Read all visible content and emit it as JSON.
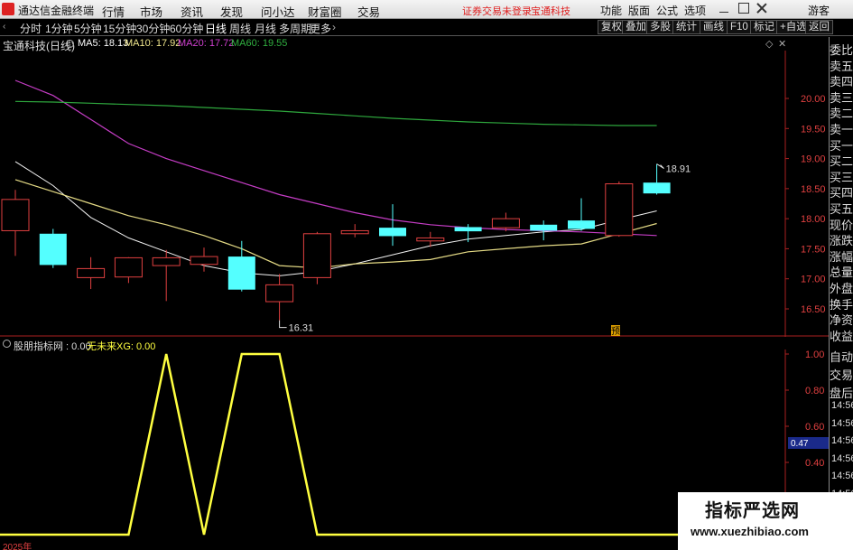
{
  "menubar": {
    "app_title": "通达信金融终端",
    "menus": [
      "行情",
      "市场",
      "资讯",
      "发现",
      "问小达",
      "财富圈",
      "交易"
    ],
    "notice_login": "证券交易未登录",
    "notice_stock": "宝通科技",
    "right_items": [
      "功能",
      "版面",
      "公式",
      "选项"
    ],
    "user": "游客"
  },
  "periodbar": {
    "periods": [
      "分时",
      "1分钟",
      "5分钟",
      "15分钟",
      "30分钟",
      "60分钟",
      "日线",
      "周线",
      "月线",
      "多周期",
      "更多"
    ],
    "active_period": "日线",
    "tools": [
      "复权",
      "叠加",
      "多股",
      "统计",
      "画线",
      "F10",
      "标记",
      "+自选",
      "返回"
    ]
  },
  "main_info": {
    "stock_label": "宝通科技(日线)",
    "ma5": "MA5: 18.13",
    "ma10": "MA10: 17.92",
    "ma20": "MA20: 17.72",
    "ma60": "MA60: 19.55"
  },
  "sub_info": {
    "indicator": "股朋指标网 : 0.00",
    "xg": "无未来XG: 0.00"
  },
  "colors": {
    "up": "#e04040",
    "down": "#54ffff",
    "ma5": "#ffffff",
    "ma10": "#f0e68c",
    "ma20": "#d040d0",
    "ma60": "#30b040",
    "indicator": "#ffff40"
  },
  "annotations": {
    "high": "18.91",
    "low": "16.31",
    "pre_badge": "预"
  },
  "chart_data": [
    {
      "type": "candlestick",
      "title": "宝通科技(日线)",
      "y_ticks": [
        "20.00",
        "19.50",
        "19.00",
        "18.50",
        "18.00",
        "17.50",
        "17.00",
        "16.50"
      ],
      "ylim": [
        16.2,
        20.5
      ],
      "candles": [
        {
          "open": 17.8,
          "close": 18.32,
          "high": 18.48,
          "low": 17.38
        },
        {
          "open": 17.75,
          "close": 17.23,
          "high": 17.83,
          "low": 17.18
        },
        {
          "open": 17.02,
          "close": 17.17,
          "high": 17.36,
          "low": 16.83
        },
        {
          "open": 17.03,
          "close": 17.35,
          "high": 17.36,
          "low": 16.93
        },
        {
          "open": 17.22,
          "close": 17.35,
          "high": 17.48,
          "low": 16.63
        },
        {
          "open": 17.24,
          "close": 17.37,
          "high": 17.52,
          "low": 17.12
        },
        {
          "open": 17.37,
          "close": 16.82,
          "high": 17.63,
          "low": 16.79
        },
        {
          "open": 16.62,
          "close": 16.9,
          "high": 17.08,
          "low": 16.31
        },
        {
          "open": 17.02,
          "close": 17.75,
          "high": 17.78,
          "low": 16.91
        },
        {
          "open": 17.75,
          "close": 17.8,
          "high": 17.91,
          "low": 17.69
        },
        {
          "open": 17.85,
          "close": 17.71,
          "high": 18.24,
          "low": 17.55
        },
        {
          "open": 17.63,
          "close": 17.68,
          "high": 17.78,
          "low": 17.53
        },
        {
          "open": 17.86,
          "close": 17.79,
          "high": 17.91,
          "low": 17.61
        },
        {
          "open": 17.85,
          "close": 18.0,
          "high": 18.1,
          "low": 17.79
        },
        {
          "open": 17.9,
          "close": 17.8,
          "high": 17.97,
          "low": 17.64
        },
        {
          "open": 17.97,
          "close": 17.83,
          "high": 18.34,
          "low": 17.8
        },
        {
          "open": 17.72,
          "close": 18.58,
          "high": 18.62,
          "low": 17.7
        },
        {
          "open": 18.6,
          "close": 18.42,
          "high": 18.91,
          "low": 18.4
        }
      ],
      "series": [
        {
          "name": "MA5",
          "values": [
            18.95,
            18.55,
            18.02,
            17.68,
            17.45,
            17.22,
            17.1,
            17.05,
            17.12,
            17.25,
            17.4,
            17.55,
            17.66,
            17.72,
            17.78,
            17.82,
            17.98,
            18.13
          ]
        },
        {
          "name": "MA10",
          "values": [
            18.65,
            18.45,
            18.25,
            18.05,
            17.9,
            17.72,
            17.5,
            17.22,
            17.18,
            17.25,
            17.28,
            17.32,
            17.45,
            17.5,
            17.55,
            17.58,
            17.75,
            17.92
          ]
        },
        {
          "name": "MA20",
          "values": [
            20.3,
            20.05,
            19.65,
            19.25,
            19.0,
            18.8,
            18.6,
            18.4,
            18.25,
            18.1,
            17.98,
            17.9,
            17.85,
            17.82,
            17.8,
            17.78,
            17.75,
            17.72
          ]
        },
        {
          "name": "MA60",
          "values": [
            19.95,
            19.94,
            19.92,
            19.9,
            19.88,
            19.85,
            19.82,
            19.79,
            19.75,
            19.71,
            19.67,
            19.64,
            19.61,
            19.59,
            19.57,
            19.56,
            19.55,
            19.55
          ]
        }
      ]
    },
    {
      "type": "line",
      "title": "股朋指标网",
      "y_ticks": [
        "1.00",
        "0.80",
        "0.60",
        "0.40",
        "0.20"
      ],
      "ylim": [
        0,
        1
      ],
      "series": [
        {
          "name": "股朋指标网",
          "values": [
            0,
            0,
            0,
            0,
            1,
            0,
            1,
            1,
            0,
            0,
            0,
            0,
            0,
            0,
            0,
            0,
            0,
            0
          ]
        }
      ]
    }
  ],
  "side_panel": {
    "labels": [
      "委比",
      "卖五",
      "卖四",
      "卖三",
      "卖二",
      "卖一",
      "买一",
      "买二",
      "买三",
      "买四",
      "买五",
      "现价",
      "涨跌",
      "涨幅",
      "总量",
      "外盘",
      "换手",
      "净资",
      "收益"
    ],
    "sub_labels": [
      "自动",
      "交易",
      "盘后"
    ],
    "times": [
      "14:56",
      "14:56",
      "14:56",
      "14:56",
      "14:56",
      "14:56",
      "14:56",
      "14:56"
    ],
    "value_box": "0.47"
  },
  "watermark": {
    "main": "指标严选网",
    "sub": "www.xuezhibiao.com"
  },
  "year_label": "2025年"
}
